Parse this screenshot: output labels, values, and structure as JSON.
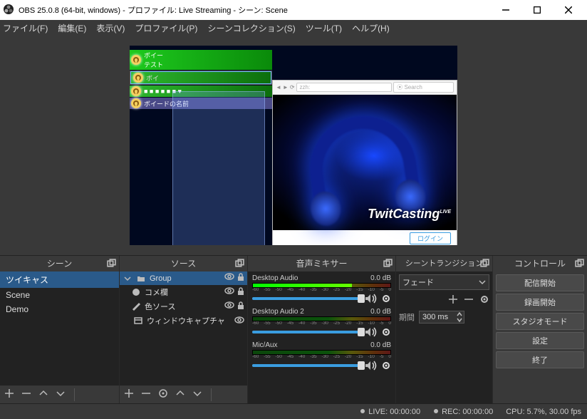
{
  "window": {
    "title": "OBS 25.0.8 (64-bit, windows) - プロファイル: Live Streaming - シーン: Scene"
  },
  "menu": {
    "file": "ファイル(F)",
    "edit": "編集(E)",
    "view": "表示(V)",
    "profile": "プロファイル(P)",
    "scene_collection": "シーンコレクション(S)",
    "tools": "ツール(T)",
    "help": "ヘルプ(H)"
  },
  "preview": {
    "comments": [
      {
        "user": "ボイー",
        "text": "テスト"
      },
      {
        "user": "ボイ",
        "text": ""
      },
      {
        "user": "",
        "text": ""
      },
      {
        "user": "ボイードの名前",
        "text": ""
      }
    ],
    "browser": {
      "url": "zzh:",
      "search": "Search"
    },
    "brand": "TwitCasting",
    "brand_sup": "LIVE"
  },
  "panels": {
    "scenes": {
      "title": "シーン",
      "items": [
        "ツイキャス",
        "Scene",
        "Demo"
      ],
      "active": 0
    },
    "sources": {
      "title": "ソース",
      "items": [
        {
          "icon": "folder",
          "label": "Group",
          "expanded": true,
          "visible": true,
          "locked": true
        },
        {
          "icon": "globe",
          "label": "コメ欄",
          "indent": true,
          "visible": true,
          "locked": true
        },
        {
          "icon": "brush",
          "label": "色ソース",
          "indent": true,
          "visible": true,
          "locked": true
        },
        {
          "icon": "window",
          "label": "ウィンドウキャプチャ",
          "visible": true,
          "locked": false
        }
      ]
    },
    "mixer": {
      "title": "音声ミキサー",
      "ticks": [
        "-60",
        "-55",
        "-50",
        "-45",
        "-40",
        "-35",
        "-30",
        "-25",
        "-20",
        "-15",
        "-10",
        "-5",
        "0"
      ],
      "channels": [
        {
          "name": "Desktop Audio",
          "db": "0.0 dB",
          "level": 72,
          "vol": 100
        },
        {
          "name": "Desktop Audio 2",
          "db": "0.0 dB",
          "level": 0,
          "vol": 100
        },
        {
          "name": "Mic/Aux",
          "db": "0.0 dB",
          "level": 0,
          "vol": 100
        }
      ]
    },
    "transitions": {
      "title": "シーントランジション",
      "current": "フェード",
      "duration_label": "期間",
      "duration": "300 ms"
    },
    "controls": {
      "title": "コントロール",
      "buttons": [
        "配信開始",
        "録画開始",
        "スタジオモード",
        "設定",
        "終了"
      ]
    }
  },
  "status": {
    "live": "LIVE: 00:00:00",
    "rec": "REC: 00:00:00",
    "cpu": "CPU: 5.7%, 30.00 fps"
  }
}
